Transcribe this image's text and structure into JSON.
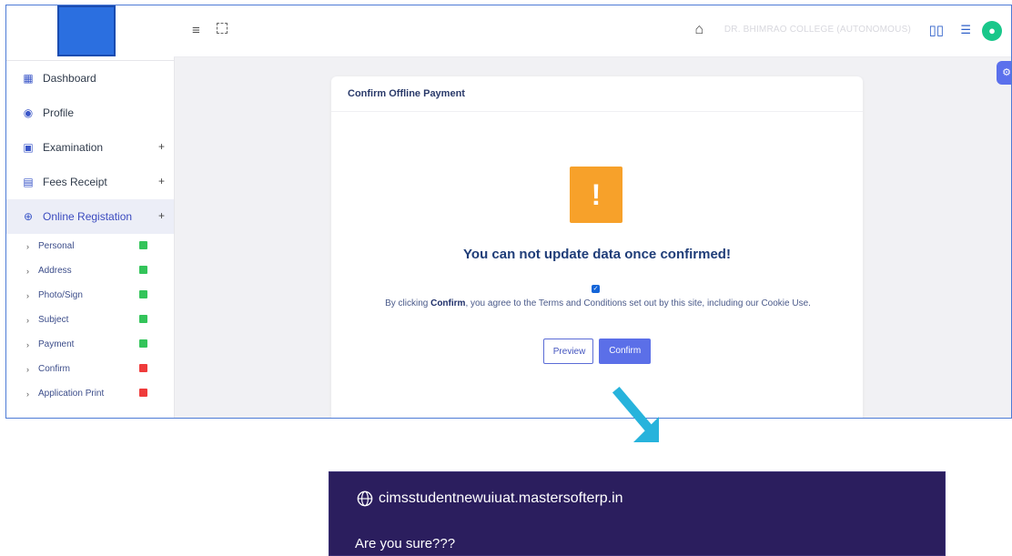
{
  "sidebar": {
    "items": [
      {
        "label": "Dashboard",
        "icon": "dashboard-icon"
      },
      {
        "label": "Profile",
        "icon": "profile-icon"
      },
      {
        "label": "Examination",
        "icon": "examination-icon",
        "expand": "+"
      },
      {
        "label": "Fees Receipt",
        "icon": "receipt-icon",
        "expand": "+"
      },
      {
        "label": "Online Registation",
        "icon": "globe-icon",
        "expand": "+"
      }
    ],
    "subitems": [
      {
        "label": "Personal",
        "status": "green"
      },
      {
        "label": "Address",
        "status": "green"
      },
      {
        "label": "Photo/Sign",
        "status": "green"
      },
      {
        "label": "Subject",
        "status": "green"
      },
      {
        "label": "Payment",
        "status": "green"
      },
      {
        "label": "Confirm",
        "status": "red"
      },
      {
        "label": "Application Print",
        "status": "red"
      }
    ]
  },
  "topbar": {
    "college": "DR. BHIMRAO COLLEGE (AUTONOMOUS)"
  },
  "card": {
    "title": "Confirm Offline Payment",
    "warning_title": "You can not update data once confirmed!",
    "terms_prefix": "By clicking ",
    "terms_bold": "Confirm",
    "terms_suffix": ", you agree to the Terms and Conditions set out by this site, including our Cookie Use.",
    "preview_label": "Preview",
    "confirm_label": "Confirm"
  },
  "dialog": {
    "url": "cimsstudentnewuiuat.mastersofterp.in",
    "message": "Are you sure???"
  },
  "colors": {
    "accent": "#5b6fe8",
    "warning": "#f7a12a",
    "dialog_bg": "#2b1e5e",
    "ok": "#33c45a",
    "pending": "#ef3b3b"
  }
}
